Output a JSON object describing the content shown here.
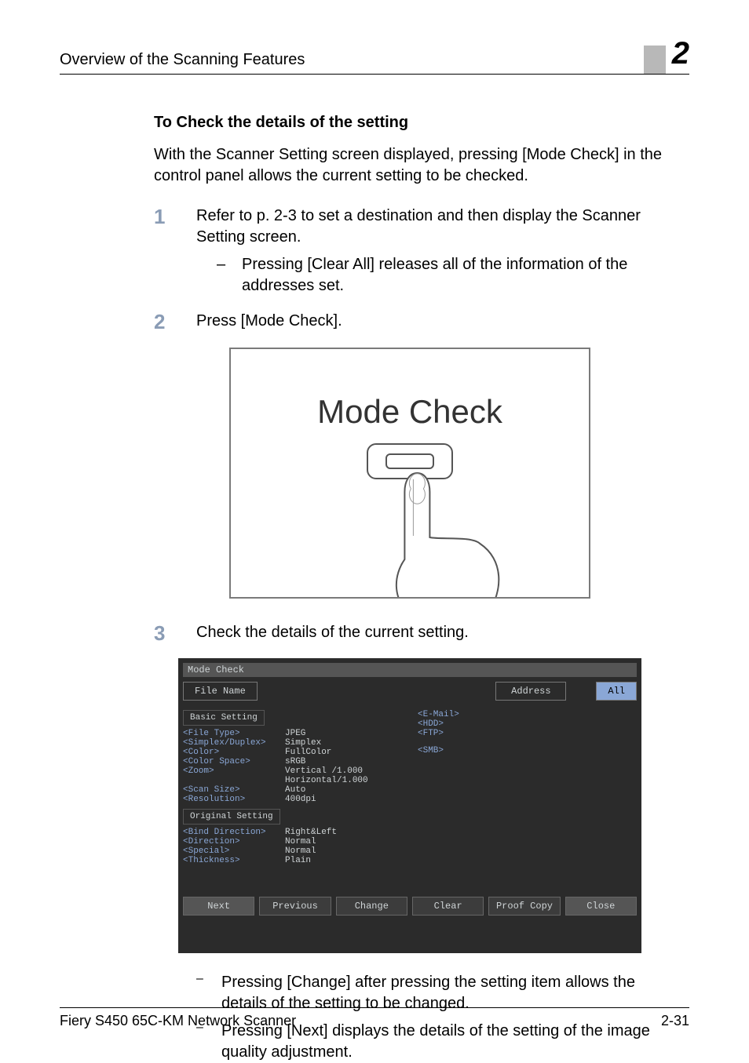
{
  "header": {
    "title": "Overview of the Scanning Features",
    "chapter_number": "2"
  },
  "section": {
    "heading": "To Check the details of the setting"
  },
  "intro": "With the Scanner Setting screen displayed, pressing [Mode Check] in the control panel allows the current setting to be checked.",
  "steps": {
    "s1": {
      "num": "1",
      "text": "Refer to p. 2-3 to set a destination and then display the Scanner Setting screen.",
      "sub1_dash": "–",
      "sub1": "Pressing [Clear All] releases all of the information of the addresses set."
    },
    "s2": {
      "num": "2",
      "text": "Press [Mode Check]."
    },
    "s3": {
      "num": "3",
      "text": "Check the details of the current setting."
    },
    "after": {
      "a_dash": "–",
      "a": "Pressing [Change] after pressing the setting item allows the details of the setting to be changed.",
      "b_dash": "–",
      "b": "Pressing [Next] displays the details of the setting of the image quality adjustment."
    }
  },
  "illustration": {
    "label": "Mode Check"
  },
  "modecheck_screen": {
    "title": "Mode Check",
    "tab_filename": "File Name",
    "tab_address": "Address",
    "tab_all": "All",
    "basic_heading": "Basic Setting",
    "kv": {
      "file_type_k": "<File Type>",
      "file_type_v": "JPEG",
      "duplex_k": "<Simplex/Duplex>",
      "duplex_v": "Simplex",
      "color_k": "<Color>",
      "color_v": "FullColor",
      "cspace_k": "<Color Space>",
      "cspace_v": "sRGB",
      "zoom_k": "<Zoom>",
      "zoom_v1": "Vertical  /1.000",
      "zoom_v2": "Horizontal/1.000",
      "scan_k": "<Scan Size>",
      "scan_v": "Auto",
      "res_k": "<Resolution>",
      "res_v": "400dpi"
    },
    "orig_heading": "Original Setting",
    "kv2": {
      "bind_k": "<Bind Direction>",
      "bind_v": "Right&Left",
      "dir_k": "<Direction>",
      "dir_v": "Normal",
      "spec_k": "<Special>",
      "spec_v": "Normal",
      "thick_k": "<Thickness>",
      "thick_v": "Plain"
    },
    "addr": {
      "email": "<E-Mail>",
      "hdd": "<HDD>",
      "ftp": "<FTP>",
      "smb": "<SMB>"
    },
    "buttons": {
      "next": "Next",
      "prev": "Previous",
      "change": "Change",
      "clear": "Clear",
      "proof": "Proof Copy",
      "close": "Close"
    }
  },
  "footer": {
    "left": "Fiery S450 65C-KM Network Scanner",
    "right": "2-31"
  }
}
